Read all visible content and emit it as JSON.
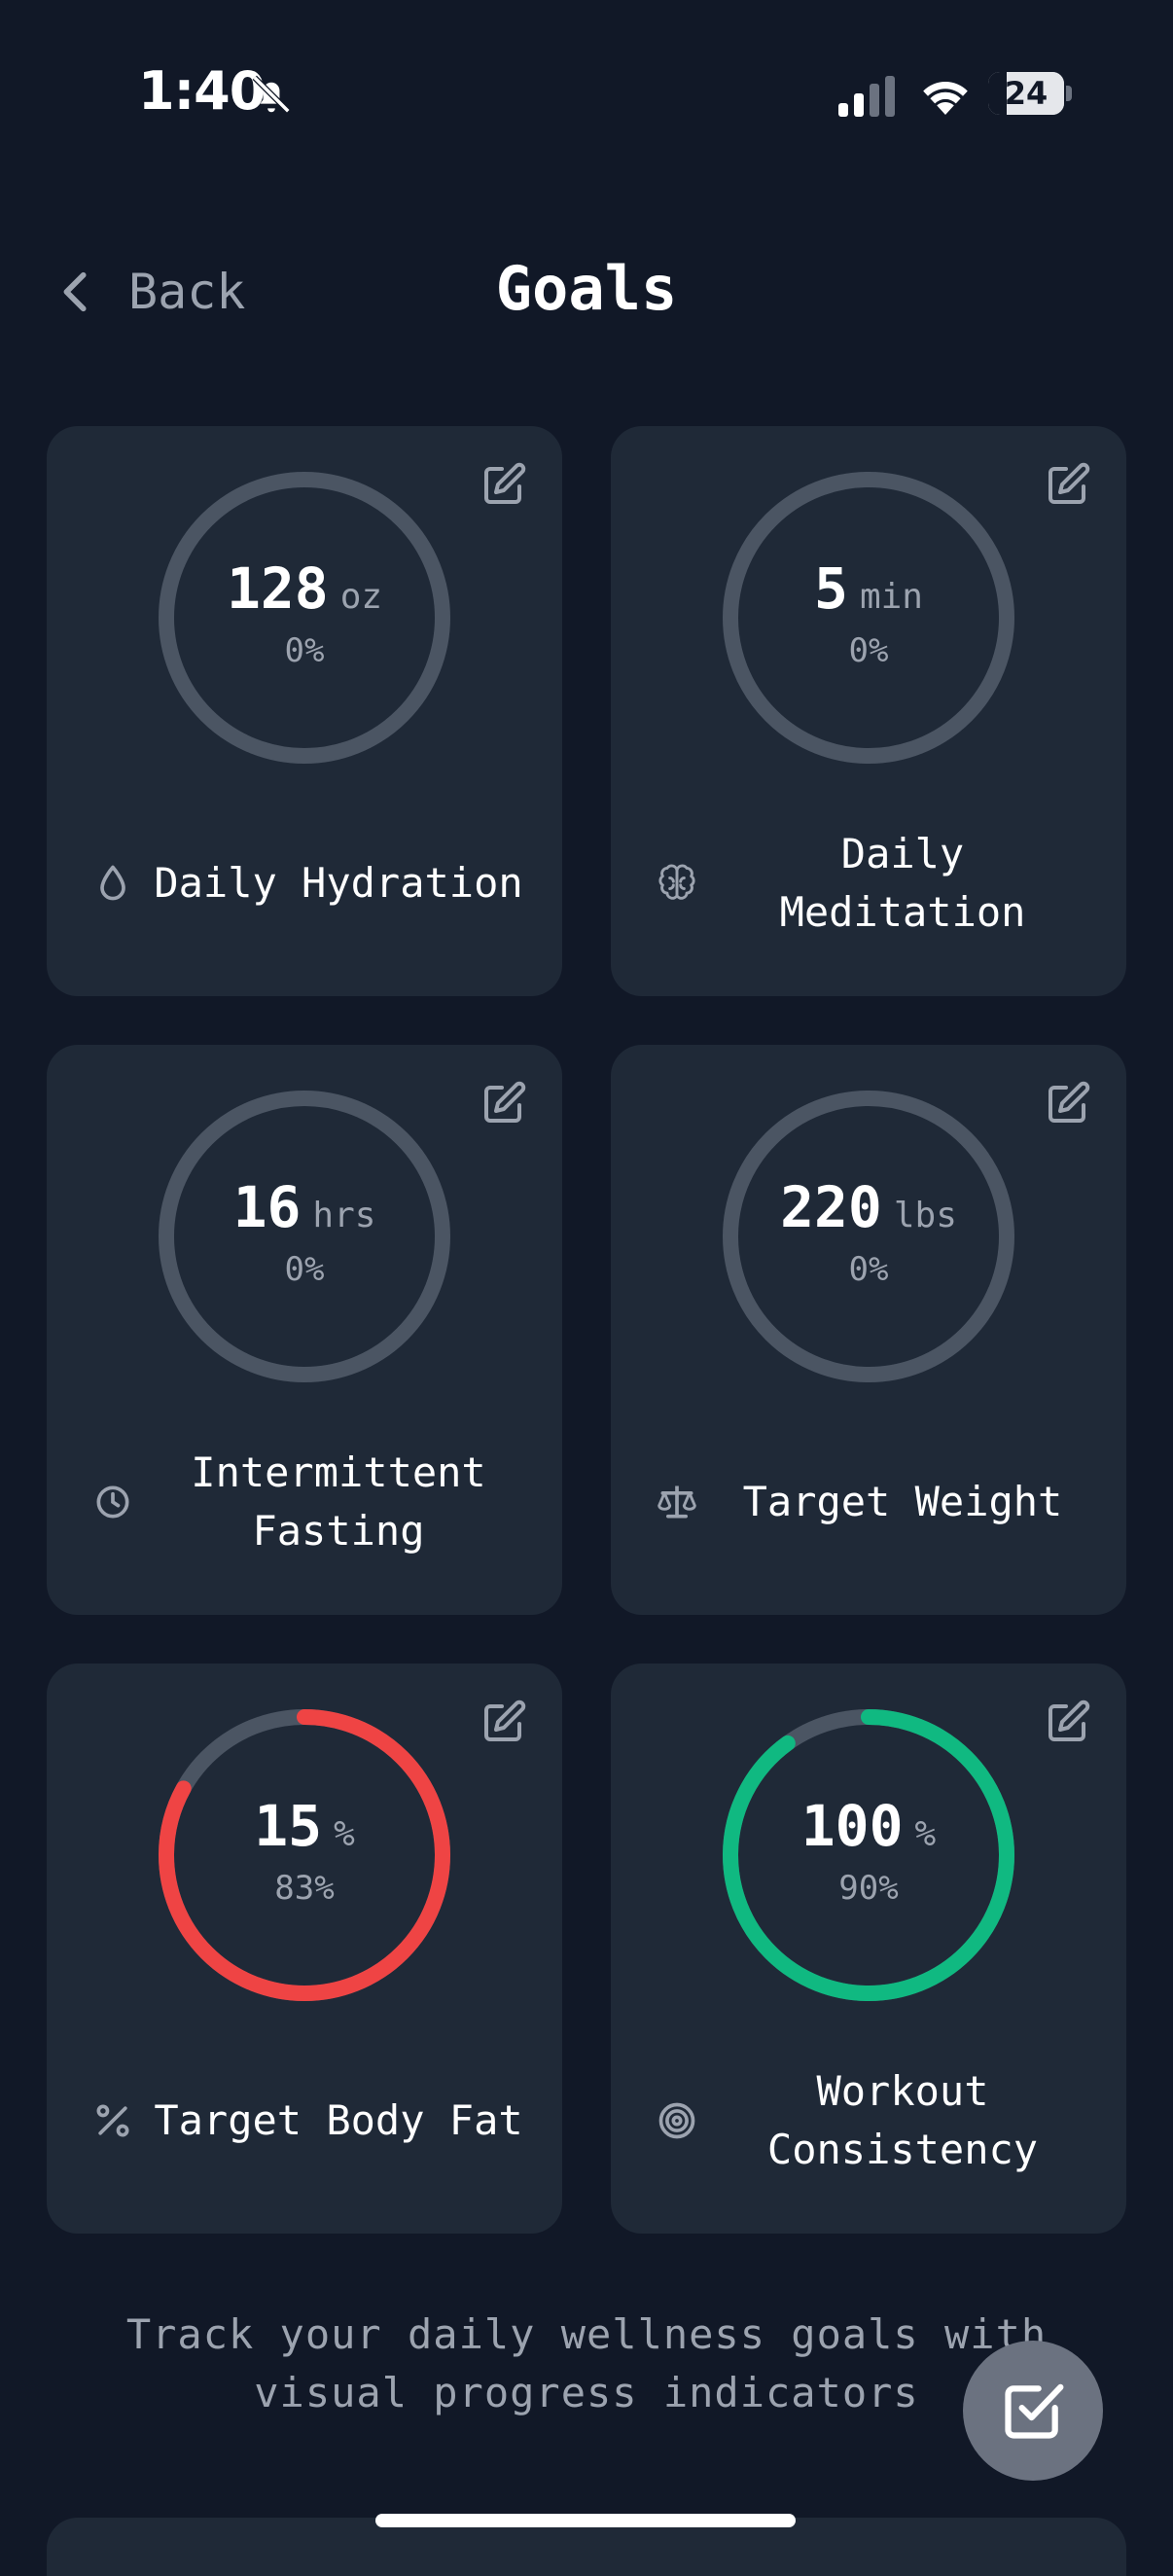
{
  "status_bar": {
    "time": "1:40",
    "battery": "24",
    "battery_level": 0.24
  },
  "header": {
    "back_label": "Back",
    "title": "Goals"
  },
  "goals": [
    {
      "name": "Daily Hydration",
      "value": "128",
      "unit": "oz",
      "percent_label": "0%",
      "progress": 0,
      "color": "#4b5563",
      "icon": "droplet-icon"
    },
    {
      "name": "Daily Meditation",
      "value": "5",
      "unit": "min",
      "percent_label": "0%",
      "progress": 0,
      "color": "#4b5563",
      "icon": "brain-icon"
    },
    {
      "name": "Intermittent Fasting",
      "value": "16",
      "unit": "hrs",
      "percent_label": "0%",
      "progress": 0,
      "color": "#4b5563",
      "icon": "clock-icon"
    },
    {
      "name": "Target Weight",
      "value": "220",
      "unit": "lbs",
      "percent_label": "0%",
      "progress": 0,
      "color": "#4b5563",
      "icon": "scale-icon"
    },
    {
      "name": "Target Body Fat",
      "value": "15",
      "unit": "%",
      "percent_label": "83%",
      "progress": 0.83,
      "color": "#ef4444",
      "icon": "percent-icon"
    },
    {
      "name": "Workout Consistency",
      "value": "100",
      "unit": "%",
      "percent_label": "90%",
      "progress": 0.9,
      "color": "#10b981",
      "icon": "target-icon"
    }
  ],
  "footer": {
    "text": "Track your daily wellness goals with visual progress indicators"
  }
}
